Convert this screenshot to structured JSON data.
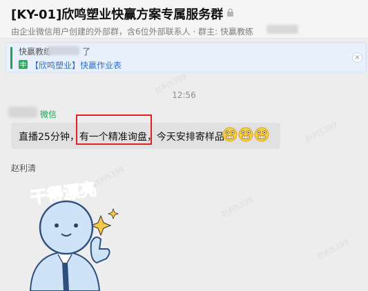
{
  "header": {
    "title": "[KY-01]欣鸣塑业快赢方案专属服务群",
    "subtitle": "由企业微信用户创建的外部群，含6位外部联系人 · 群主: 快赢教练"
  },
  "pinned": {
    "line1_prefix": "快赢教练",
    "line1_suffix": "了",
    "link_text": "【欣鸣塑业】快赢作业表",
    "close_glyph": "×"
  },
  "chat": {
    "time": "12:56",
    "message": {
      "sender_tag": "微信",
      "text": "直播25分钟，有一个精准询盘，今天安排寄样品"
    },
    "second_sender": "赵利清"
  },
  "sticker": {
    "caption": "干得漂亮"
  },
  "watermark": {
    "text": "赵利5399"
  },
  "colors": {
    "highlight_box": "#e02020",
    "wechat_tag": "#1ea356",
    "link": "#2f6fd3",
    "sticker_face": "#cfe3f8"
  },
  "icons": {
    "lock": "lock-icon",
    "sheet": "spreadsheet-icon",
    "close": "close-icon",
    "emoji": "grimacing-face-emoji"
  }
}
